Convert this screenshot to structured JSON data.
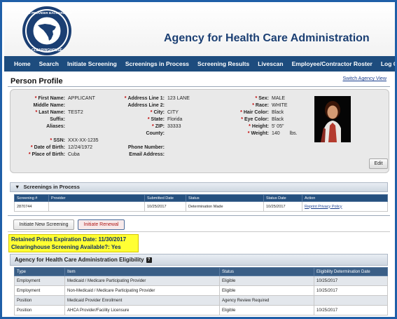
{
  "header": {
    "seal_text_top": "CARE PROVIDER BACKGROUND SCREENING",
    "seal_text_bottom": "CLEARINGHOUSE",
    "agency_title": "Agency for Health Care Administration"
  },
  "nav": [
    {
      "label": "Home"
    },
    {
      "label": "Search"
    },
    {
      "label": "Initiate Screening"
    },
    {
      "label": "Screenings in Process"
    },
    {
      "label": "Screening Results"
    },
    {
      "label": "Livescan"
    },
    {
      "label": "Employee/Contractor Roster"
    },
    {
      "label": "Log Out"
    }
  ],
  "page": {
    "title": "Person Profile",
    "switch_link": "Switch Agency View"
  },
  "profile": {
    "first_name": {
      "label": "First Name:",
      "value": "APPLICANT"
    },
    "middle_name": {
      "label": "Middle Name:",
      "value": ""
    },
    "last_name": {
      "label": "Last Name:",
      "value": "TEST2"
    },
    "suffix": {
      "label": "Suffix:",
      "value": ""
    },
    "aliases": {
      "label": "Aliases:",
      "value": ""
    },
    "ssn": {
      "label": "SSN:",
      "value": "XXX-XX-1235"
    },
    "dob": {
      "label": "Date of Birth:",
      "value": "12/24/1972"
    },
    "pob": {
      "label": "Place of Birth:",
      "value": "Cuba"
    },
    "address1": {
      "label": "Address Line 1:",
      "value": "123 LANE"
    },
    "address2": {
      "label": "Address Line 2:",
      "value": ""
    },
    "city": {
      "label": "City:",
      "value": "CITY"
    },
    "state": {
      "label": "State:",
      "value": "Florida"
    },
    "zip": {
      "label": "ZIP:",
      "value": "33333"
    },
    "county": {
      "label": "County:",
      "value": ""
    },
    "phone": {
      "label": "Phone Number:",
      "value": ""
    },
    "email": {
      "label": "Email Address:",
      "value": ""
    },
    "sex": {
      "label": "Sex:",
      "value": "MALE"
    },
    "race": {
      "label": "Race:",
      "value": "WHITE"
    },
    "hair": {
      "label": "Hair Color:",
      "value": "Black"
    },
    "eye": {
      "label": "Eye Color:",
      "value": "Black"
    },
    "height": {
      "label": "Height:",
      "value": "5' 05\""
    },
    "weight": {
      "label": "Weight:",
      "value": "140",
      "unit": "lbs."
    },
    "required_mark": "*",
    "edit_label": "Edit"
  },
  "screenings": {
    "title": "Screenings in Process",
    "toggle_icon": "triangle-down-icon",
    "columns": [
      "Screening #",
      "Provider",
      "Submitted Date",
      "Status",
      "Status Date",
      "Action"
    ],
    "rows": [
      {
        "screening_no": "2870744",
        "provider": "",
        "submitted": "10/25/2017",
        "status": "Determination Made",
        "status_date": "10/25/2017",
        "action": "Reprint Privacy Policy"
      }
    ]
  },
  "tabs": {
    "initiate_new": "Initiate New Screening",
    "initiate_renewal": "Initiate Renewal"
  },
  "callout": {
    "line1": "Retained Prints Expiration Date: 11/30/2017",
    "line2": "Clearinghouse Screening Available?: Yes"
  },
  "eligibility": {
    "title": "Agency for Health Care Administration Eligibility",
    "help": "?",
    "columns": [
      "Type",
      "Item",
      "Status",
      "Eligibility Determination Date"
    ],
    "rows": [
      {
        "type": "Employment",
        "item": "Medicaid / Medicare Participating Provider",
        "status": "Eligible",
        "date": "10/25/2017"
      },
      {
        "type": "Employment",
        "item": "Non-Medicaid / Medicare Participating Provider",
        "status": "Eligible",
        "date": "10/25/2017"
      },
      {
        "type": "Position",
        "item": "Medicaid Provider Enrollment",
        "status": "Agency Review Required",
        "date": ""
      },
      {
        "type": "Position",
        "item": "AHCA Provider/Facility Licensure",
        "status": "Eligible",
        "date": "10/25/2017"
      }
    ]
  },
  "colors": {
    "nav_bg": "#1d4c7e",
    "title_color": "#1b3f73",
    "table_header": "#25507f",
    "callout_bg": "#ffff33",
    "required": "#c00000"
  }
}
